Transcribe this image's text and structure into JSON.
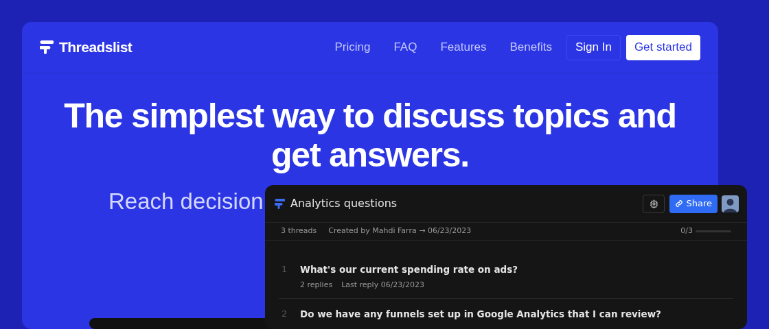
{
  "brand": {
    "name": "Threadslist"
  },
  "nav": {
    "links": [
      "Pricing",
      "FAQ",
      "Features",
      "Benefits"
    ],
    "sign_in": "Sign In",
    "cta": "Get started"
  },
  "hero": {
    "headline": "The simplest way to discuss topics and get answers.",
    "subtitle": "Reach decision"
  },
  "preview": {
    "title": "Analytics questions",
    "share": "Share",
    "thread_count": "3 threads",
    "created": "Created by Mahdi Farra → 06/23/2023",
    "progress_text": "0/3",
    "progress": {
      "level": 0
    },
    "threads": [
      {
        "number": "1",
        "title": "What's our current spending rate on ads?",
        "replies": "2 replies",
        "last_reply": "Last reply 06/23/2023"
      },
      {
        "number": "2",
        "title": "Do we have any funnels set up in Google Analytics that I can review?"
      }
    ]
  }
}
